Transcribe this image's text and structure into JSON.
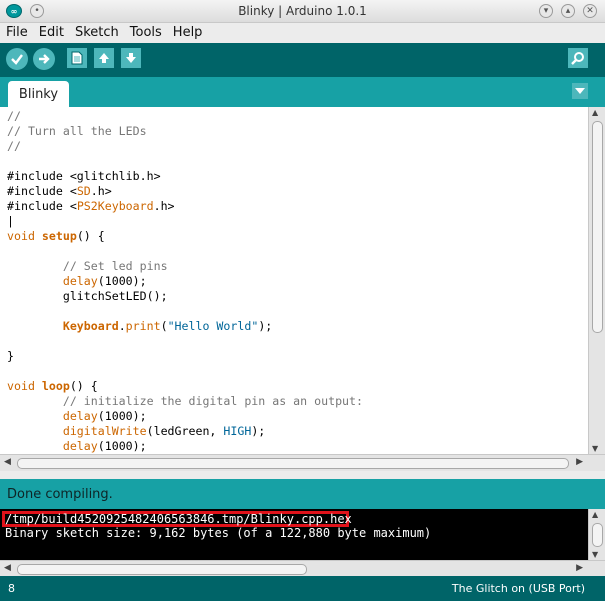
{
  "window": {
    "title": "Blinky | Arduino 1.0.1",
    "app_icon": "arduino-logo-icon",
    "buttons": [
      "chevron-down-icon",
      "chevron-up-icon",
      "close-icon"
    ]
  },
  "menu": {
    "items": [
      "File",
      "Edit",
      "Sketch",
      "Tools",
      "Help"
    ]
  },
  "toolbar": {
    "buttons": [
      {
        "name": "verify",
        "icon": "checkmark-icon"
      },
      {
        "name": "upload",
        "icon": "right-arrow-icon"
      },
      {
        "name": "new",
        "icon": "new-document-icon"
      },
      {
        "name": "open",
        "icon": "open-up-arrow-icon"
      },
      {
        "name": "save",
        "icon": "save-down-arrow-icon"
      },
      {
        "name": "serial-monitor",
        "icon": "magnifier-icon"
      }
    ]
  },
  "tabs": {
    "items": [
      {
        "label": "Blinky"
      }
    ],
    "menu_icon": "triangle-down-icon"
  },
  "code": {
    "line1": "//",
    "line2": "// Turn all the LEDs",
    "line3": "//",
    "inc1_kw": "#include <glitchlib.h>",
    "inc2_kw": "#include <",
    "inc2_lib": "SD",
    "inc2_end": ".h>",
    "inc3_kw": "#include <",
    "inc3_lib": "PS2Keyboard",
    "inc3_end": ".h>",
    "setup_void": "void",
    "setup_name": "setup",
    "setup_rest": "() {",
    "comment_pins": "// Set led pins",
    "delay": "delay",
    "delay_arg": "(1000);",
    "glitch_call": "glitchSetLED();",
    "keyboard": "Keyboard",
    "print": "print",
    "print_open": "(",
    "hello": "\"Hello World\"",
    "print_close": ");",
    "close_brace": "}",
    "loop_void": "void",
    "loop_name": "loop",
    "loop_rest": "() {",
    "comment_init": "// initialize the digital pin as an output:",
    "digitalwrite": "digitalWrite",
    "dw_args": "(ledGreen, ",
    "high": "HIGH",
    "dw_end": ");"
  },
  "status": {
    "message": "Done compiling."
  },
  "console": {
    "line1": "/tmp/build4520925482406563846.tmp/Blinky.cpp.hex",
    "line2": "Binary sketch size: 9,162 bytes (of a 122,880 byte maximum)",
    "highlight_color": "#e0121a"
  },
  "footer": {
    "line_number": "8",
    "board": "The Glitch on (USB Port)"
  },
  "colors": {
    "teal_dark": "#006468",
    "teal": "#17a1a5",
    "button": "#4db7bb",
    "keyword": "#cc6600",
    "string": "#006699"
  }
}
